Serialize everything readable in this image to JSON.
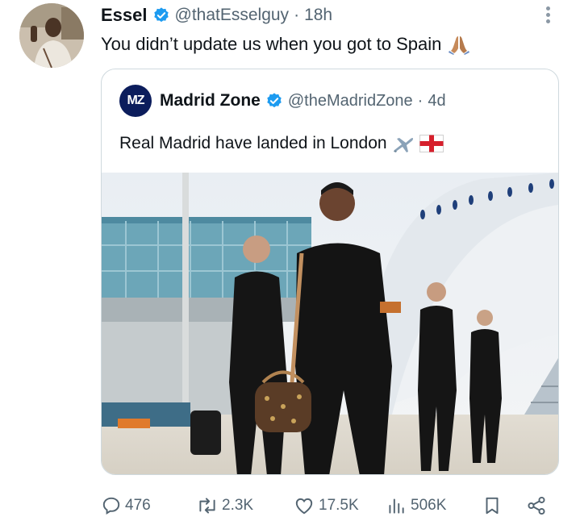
{
  "tweet": {
    "author_name": "Essel",
    "handle": "@thatEsselguy",
    "separator": "·",
    "time": "18h",
    "text": "You didn’t update us when you got to Spain",
    "emoji": "pray-icon"
  },
  "quote": {
    "logo_text": "MZ",
    "author_name": "Madrid Zone",
    "handle": "@theMadridZone",
    "separator": "·",
    "time": "4d",
    "text": "Real Madrid have landed in London",
    "emojis": [
      "airplane-icon",
      "england-flag-icon"
    ]
  },
  "actions": {
    "replies": "476",
    "reposts": "2.3K",
    "likes": "17.5K",
    "views": "506K"
  },
  "colors": {
    "verified": "#1d9bf0",
    "secondary_text": "#536471",
    "border": "#cfd9de",
    "logo_bg": "#0c1d5c"
  }
}
